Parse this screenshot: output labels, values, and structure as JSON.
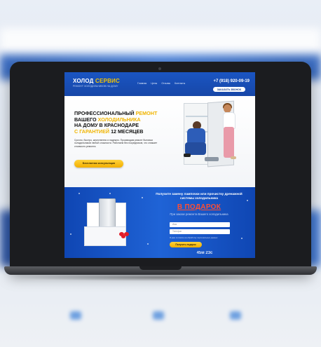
{
  "site": {
    "logo_primary": "ХОЛОД",
    "logo_accent": "СЕРВИС",
    "logo_tagline": "РЕМОНТ ХОЛОДИЛЬНИКОВ НА ДОМУ",
    "nav": [
      "Главная",
      "Цены",
      "Отзывы",
      "Контакты"
    ],
    "phone": "+7 (918) 920-09-19",
    "call_button": "ЗАКАЗАТЬ ЗВОНОК"
  },
  "hero": {
    "title_part1": "ПРОФЕССИОНАЛЬНЫЙ",
    "title_accent1": "РЕМОНТ",
    "title_part2": "ВАШЕГО",
    "title_accent2": "ХОЛОДИЛЬНИКА",
    "title_part3": "НА ДОМУ В КРАСНОДАРЕ",
    "title_accent3": "С ГАРАНТИЕЙ",
    "title_part4": "12 МЕСЯЦЕВ",
    "description": "Срочно, быстро, качественно и надежно. Производим ремонт бытовых холодильников любой сложности. Работаем без посредников, что снижает стоимость ремонта.",
    "button": "Бесплатная консультация"
  },
  "promo": {
    "title": "Получите замену лампочки или прочистку дренажной системы холодильника",
    "highlight": "В ПОДАРОК",
    "subtitle": "При заказе ремонта Вашего холодильника",
    "name_placeholder": "Имя",
    "phone_placeholder": "Телефон",
    "consent": "Я даю согласие на обработку персональных данных",
    "button": "Получить подарок",
    "timer": "45м 23с"
  },
  "colors": {
    "brand_blue": "#1a55c2",
    "accent_yellow": "#f2ae00",
    "gift_red": "#e11e2a"
  }
}
